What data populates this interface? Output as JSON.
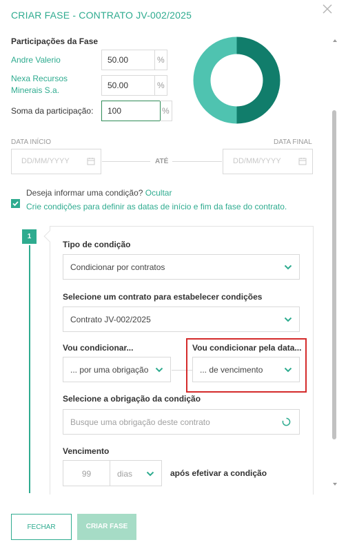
{
  "header": {
    "title": "CRIAR FASE - CONTRATO JV-002/2025",
    "close_icon": "close-icon"
  },
  "participation": {
    "heading": "Participações da Fase",
    "rows": [
      {
        "name": "Andre Valerio",
        "value": "50.00",
        "unit": "%"
      },
      {
        "name": "Nexa Recursos Minerais S.a.",
        "value": "50.00",
        "unit": "%"
      }
    ],
    "sum_label": "Soma da participação:",
    "sum_value": "100",
    "sum_unit": "%",
    "chart": {
      "type": "donut",
      "slices": [
        50,
        50
      ],
      "colors": [
        "#117d6b",
        "#4fc3b0"
      ]
    }
  },
  "dates": {
    "start_label": "DATA INÍCIO",
    "end_label": "DATA FINAL",
    "start_placeholder": "DD/MM/YYYY",
    "end_placeholder": "DD/MM/YYYY",
    "between_label": "ATÉ"
  },
  "condition": {
    "question": "Deseja informar uma condição?",
    "hide_link": "Ocultar",
    "checked": true,
    "hint": "Crie condições para definir as datas de início e fim da fase do contrato."
  },
  "step": {
    "number": "1",
    "type_label": "Tipo de condição",
    "type_value": "Condicionar por contratos",
    "contract_label": "Selecione um contrato para estabelecer condições",
    "contract_value": "Contrato JV-002/2025",
    "condition_by_label": "Vou condicionar...",
    "condition_by_value": "... por uma obrigação",
    "condition_date_label": "Vou condicionar pela data...",
    "condition_date_value": "... de vencimento",
    "obligation_label": "Selecione a obrigação da condição",
    "obligation_placeholder": "Busque uma obrigação deste contrato",
    "due_label": "Vencimento",
    "due_value": "99",
    "due_unit": "dias",
    "due_after": "após efetivar a condição"
  },
  "footer": {
    "close_label": "FECHAR",
    "create_label": "CRIAR FASE"
  },
  "colors": {
    "accent": "#2eab8f",
    "highlight": "#d42a2a",
    "button_disabled": "#a6dcc6"
  }
}
